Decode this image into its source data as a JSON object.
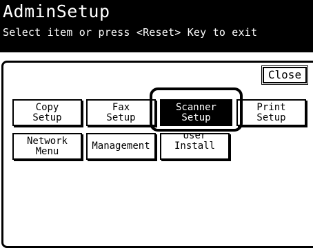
{
  "header": {
    "title": "AdminSetup",
    "subtitle": "Select item or press <Reset> Key to exit"
  },
  "close_label": "Close",
  "menu": {
    "copy_setup": "Copy\nSetup",
    "fax_setup": "Fax\nSetup",
    "scanner_setup": "Scanner\nSetup",
    "print_setup": "Print\nSetup",
    "network_menu": "Network\nMenu",
    "management": "Management",
    "user_install": "User\nInstall"
  },
  "selected_item": "scanner_setup"
}
